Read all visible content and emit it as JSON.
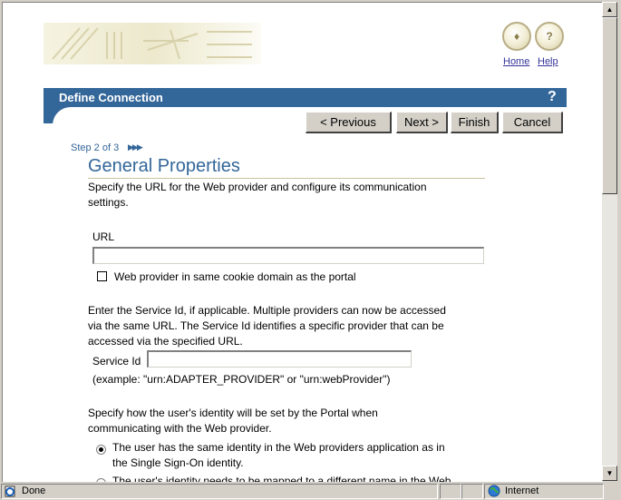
{
  "header": {
    "home_label": "Home",
    "help_label": "Help",
    "home_icon": "home-book-icon",
    "help_icon": "question-mark-icon",
    "help_glyph": "?",
    "home_glyph": "♦"
  },
  "titlebar": {
    "title": "Define Connection",
    "help_glyph": "?"
  },
  "buttons": {
    "previous": "< Previous",
    "next": "Next >",
    "finish": "Finish",
    "cancel": "Cancel"
  },
  "step": {
    "text": "Step 2 of 3",
    "arrows": "▶▶▶"
  },
  "section": {
    "title": "General Properties",
    "description_line1": "Specify the URL for the Web provider and configure its communication",
    "description_line2": "settings."
  },
  "url": {
    "label": "URL",
    "value": "",
    "cookie_checkbox_label": "Web provider in same cookie domain as the portal",
    "cookie_checked": false
  },
  "service": {
    "desc_line1": "Enter the Service Id, if applicable. Multiple providers can now be accessed",
    "desc_line2": "via the same URL. The Service Id identifies a specific provider that can be",
    "desc_line3": "accessed via the specified URL.",
    "label": "Service Id",
    "value": "",
    "example": "(example: \"urn:ADAPTER_PROVIDER\" or \"urn:webProvider\")"
  },
  "identity": {
    "desc_line1": "Specify how the user's identity will be set by the Portal when",
    "desc_line2": "communicating with the Web provider.",
    "option1_line1": "The user has the same identity in the Web providers application as in",
    "option1_line2": "the Single Sign-On identity.",
    "option1_selected": true,
    "option2_line1": "The user's identity needs to be mapped to a different name in the Web",
    "option2_selected": false
  },
  "statusbar": {
    "status": "Done",
    "zone": "Internet",
    "page_icon": "ie-page-icon",
    "zone_icon": "globe-icon"
  },
  "scrollbar": {
    "up_glyph": "▲",
    "down_glyph": "▼"
  }
}
